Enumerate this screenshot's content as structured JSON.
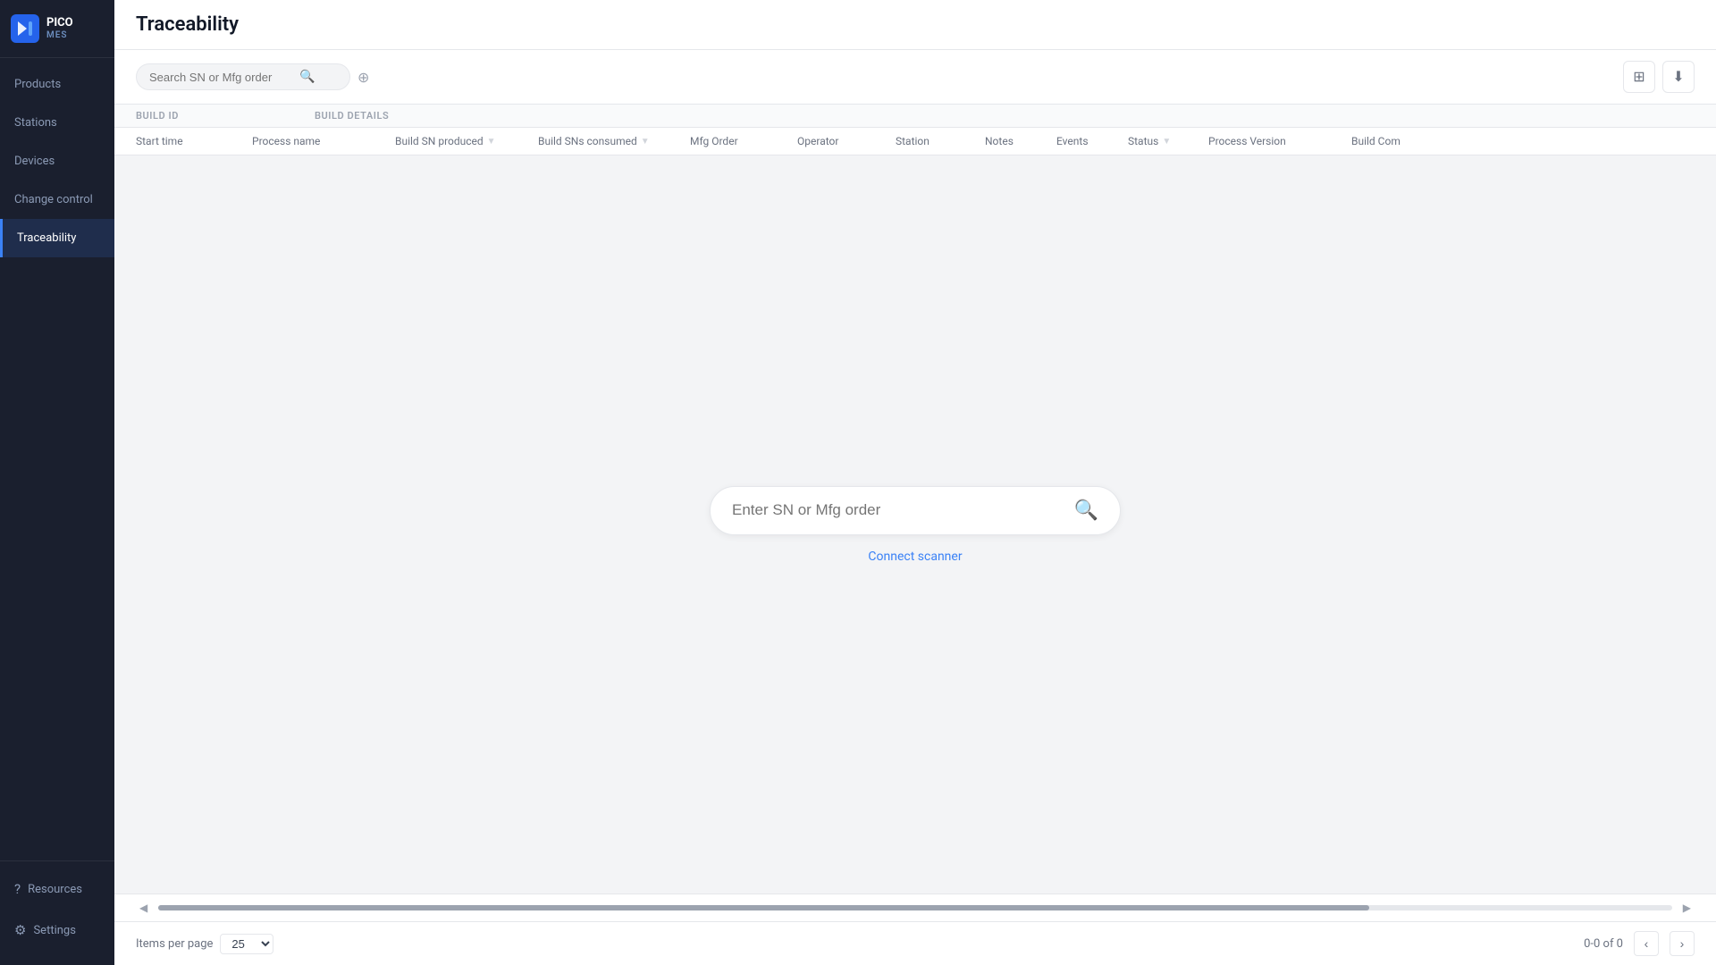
{
  "app": {
    "name": "PICO",
    "subtitle": "MES"
  },
  "sidebar": {
    "items": [
      {
        "id": "products",
        "label": "Products",
        "active": false
      },
      {
        "id": "stations",
        "label": "Stations",
        "active": false
      },
      {
        "id": "devices",
        "label": "Devices",
        "active": false
      },
      {
        "id": "change-control",
        "label": "Change control",
        "active": false
      },
      {
        "id": "traceability",
        "label": "Traceability",
        "active": true
      }
    ],
    "bottom_items": [
      {
        "id": "resources",
        "label": "Resources"
      },
      {
        "id": "settings",
        "label": "Settings"
      }
    ]
  },
  "header": {
    "title": "Traceability"
  },
  "search": {
    "small_placeholder": "Search SN or Mfg order",
    "big_placeholder": "Enter SN or Mfg order",
    "connect_scanner": "Connect scanner"
  },
  "table": {
    "group_labels": {
      "build_id": "BUILD ID",
      "build_details": "BUILD DETAILS"
    },
    "columns": [
      {
        "id": "start-time",
        "label": "Start time",
        "sortable": false
      },
      {
        "id": "process-name",
        "label": "Process name",
        "sortable": false
      },
      {
        "id": "build-sn-produced",
        "label": "Build SN produced",
        "sortable": true
      },
      {
        "id": "build-sns-consumed",
        "label": "Build SNs consumed",
        "sortable": true
      },
      {
        "id": "mfg-order",
        "label": "Mfg Order",
        "sortable": false
      },
      {
        "id": "operator",
        "label": "Operator",
        "sortable": false
      },
      {
        "id": "station",
        "label": "Station",
        "sortable": false
      },
      {
        "id": "notes",
        "label": "Notes",
        "sortable": false
      },
      {
        "id": "events",
        "label": "Events",
        "sortable": false
      },
      {
        "id": "status",
        "label": "Status",
        "sortable": true
      },
      {
        "id": "process-version",
        "label": "Process Version",
        "sortable": false
      },
      {
        "id": "build-com",
        "label": "Build Com",
        "sortable": false
      }
    ]
  },
  "footer": {
    "items_per_page_label": "Items per page",
    "items_per_page_value": "25",
    "pagination_info": "0-0 of 0"
  },
  "toolbar": {
    "scan_icon": "⊞",
    "download_icon": "⬇"
  }
}
